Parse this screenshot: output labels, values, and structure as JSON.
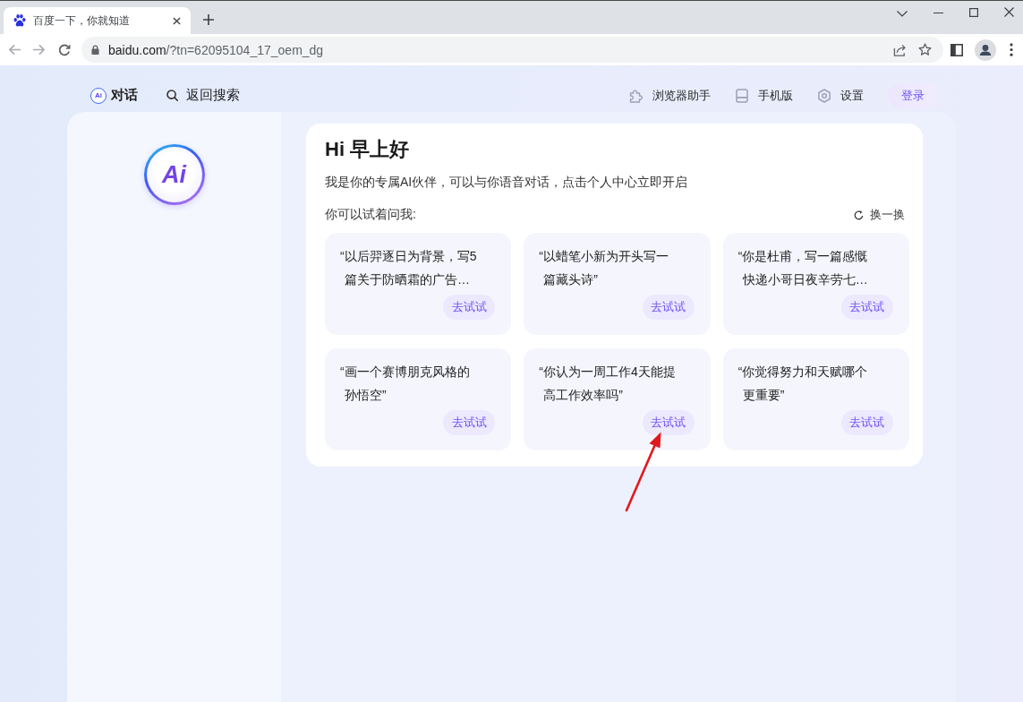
{
  "browser": {
    "tabs": [
      {
        "title": "百度一下，你就知道",
        "selected": true
      }
    ],
    "address": {
      "host": "baidu.com",
      "path": "/?tn=62095104_17_oem_dg"
    }
  },
  "nav": {
    "brand": {
      "icon_text": "Ai",
      "label": "对话"
    },
    "back_search": "返回搜索",
    "links": [
      "浏览器助手",
      "手机版",
      "设置"
    ],
    "login": "登录"
  },
  "sidebar": {
    "logo_text": "Ai"
  },
  "chat": {
    "greeting": "Hi 早上好",
    "intro": "我是你的专属AI伙伴，可以与你语音对话，点击个人中心立即开启",
    "prompt_label": "你可以试着问我:",
    "refresh": "换一换",
    "suggestions": [
      {
        "text": "“以后羿逐日为背景，写5篇关于防晒霜的广告…",
        "button": "去试试"
      },
      {
        "text": "“以蜡笔小新为开头写一篇藏头诗”",
        "button": "去试试"
      },
      {
        "text": "“你是杜甫，写一篇感慨快递小哥日夜辛劳七…",
        "button": "去试试"
      },
      {
        "text": "“画一个赛博朋克风格的孙悟空”",
        "button": "去试试"
      },
      {
        "text": "“你认为一周工作4天能提高工作效率吗”",
        "button": "去试试"
      },
      {
        "text": "“你觉得努力和天赋哪个更重要”",
        "button": "去试试"
      }
    ]
  }
}
